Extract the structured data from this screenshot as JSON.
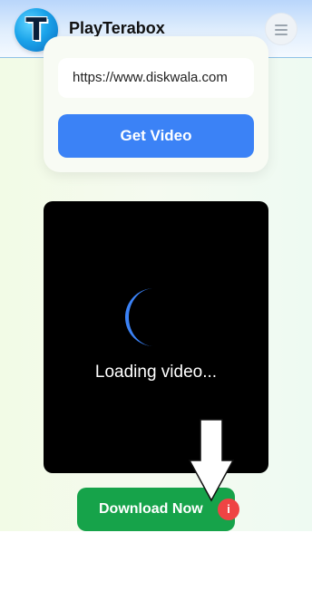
{
  "header": {
    "logo_letter": "T",
    "brand": "PlayTerabox",
    "menu_icon": "hamburger-menu-icon"
  },
  "form": {
    "url_value": "https://www.diskwala.com",
    "get_video_label": "Get Video"
  },
  "player": {
    "loading_text": "Loading video...",
    "spinner_icon": "loading-spinner-icon"
  },
  "download": {
    "label": "Download Now",
    "badge": "i"
  },
  "colors": {
    "primary_blue": "#3b82f6",
    "download_green": "#16a34a",
    "badge_red": "#ef4444",
    "spinner_blue": "#3b82f6"
  }
}
